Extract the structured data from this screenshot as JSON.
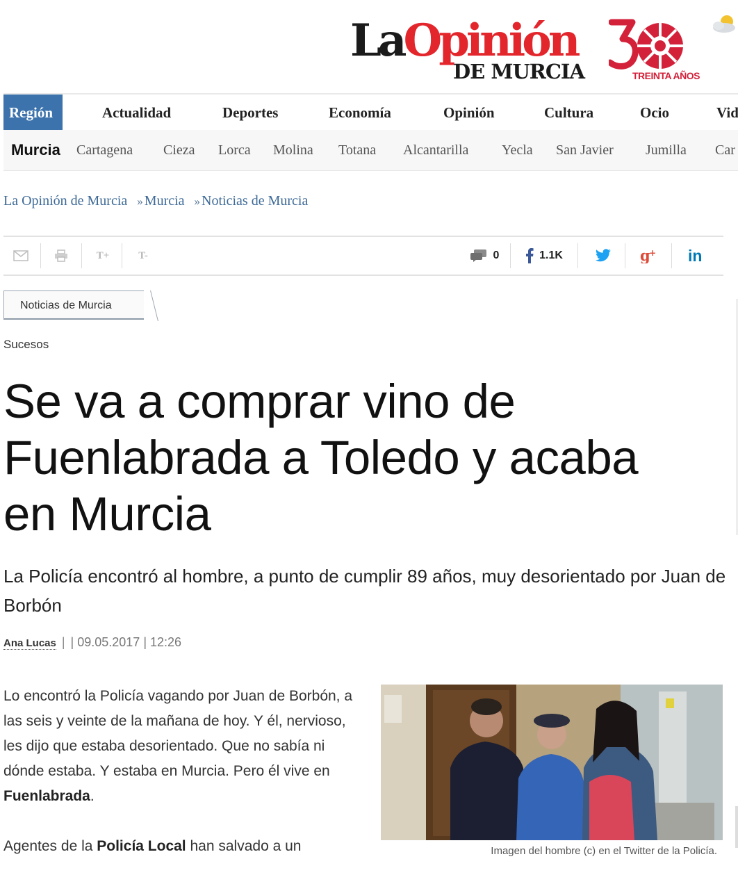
{
  "header": {
    "logo_la": "La",
    "logo_opinion": "Opinión",
    "logo_sub": "DE MURCIA",
    "anniversary": "TREINTA AÑOS",
    "weather_icon": "partly-cloudy-icon"
  },
  "main_nav": [
    "Región",
    "Actualidad",
    "Deportes",
    "Economía",
    "Opinión",
    "Cultura",
    "Ocio",
    "Vid"
  ],
  "sub_nav": [
    "Murcia",
    "Cartagena",
    "Cieza",
    "Lorca",
    "Molina",
    "Totana",
    "Alcantarilla",
    "Yecla",
    "San Javier",
    "Jumilla",
    "Car"
  ],
  "breadcrumb": [
    "La Opinión de Murcia",
    "Murcia",
    "Noticias de Murcia"
  ],
  "breadcrumb_sep": "»",
  "tools": {
    "text_increase": "T+",
    "text_decrease": "T-",
    "comments_count": "0",
    "facebook_count": "1.1K"
  },
  "section_tab": "Noticias de Murcia",
  "category": "Sucesos",
  "article": {
    "title": "Se va a comprar vino de Fuenlabrada a Toledo y acaba en Murcia",
    "subtitle": "La Policía encontró al hombre, a punto de cumplir 89 años, muy desorientado por Juan de Borbón",
    "author": "Ana Lucas",
    "date": "| 09.05.2017 | 12:26",
    "p1_text": "Lo encontró la Policía vagando por Juan de Borbón, a las seis y veinte de la mañana de hoy. Y él, nervioso, les dijo que estaba desorientado. Que no sabía ni dónde estaba. Y estaba en Murcia. Pero él vive en ",
    "p1_bold": "Fuenlabrada",
    "p1_end": ".",
    "p2_start": "Agentes de la ",
    "p2_bold": "Policía Local",
    "p2_end": " han salvado a un",
    "photo_caption": "Imagen del hombre (c) en el Twitter de la Policía."
  },
  "colors": {
    "brand_red": "#e3262c",
    "nav_active": "#3c73ac",
    "link_blue": "#3e6a97",
    "facebook": "#3b5998",
    "twitter": "#1da1f2",
    "google_plus": "#dd4b39",
    "linkedin": "#0077b5"
  }
}
